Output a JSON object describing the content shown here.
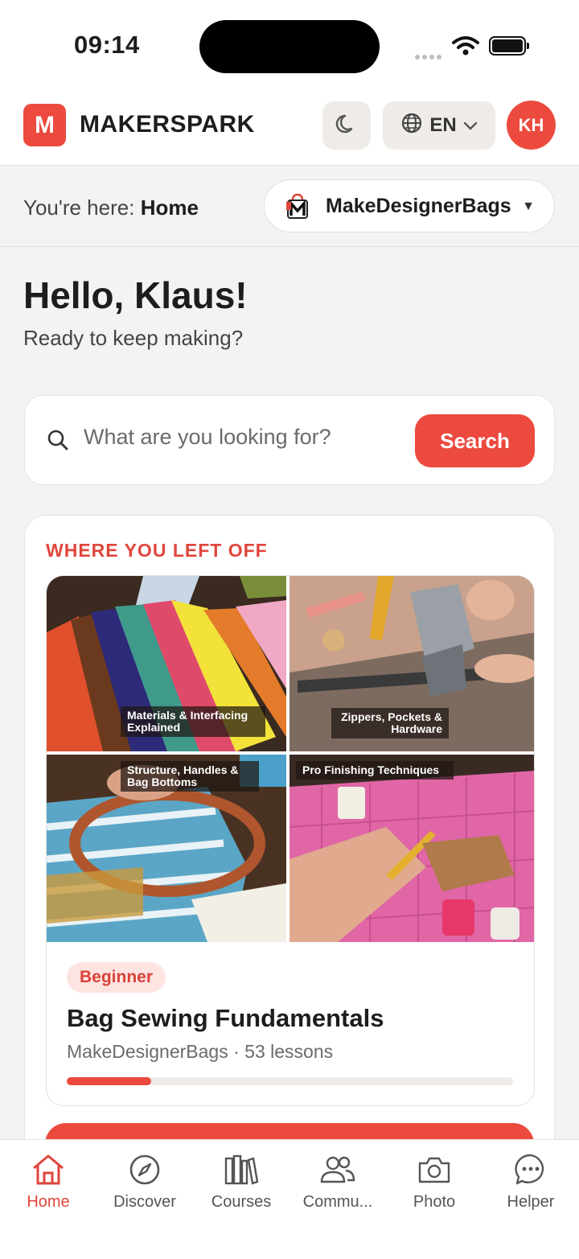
{
  "status_bar": {
    "time": "09:14"
  },
  "header": {
    "logo_letter": "M",
    "brand": "MAKERSPARK",
    "language": "EN",
    "avatar_initials": "KH"
  },
  "breadcrumb": {
    "prefix": "You're here:",
    "current": "Home",
    "brand_selector": "MakeDesignerBags"
  },
  "greeting": {
    "title": "Hello, Klaus!",
    "subtitle": "Ready to keep making?"
  },
  "search": {
    "placeholder": "What are you looking for?",
    "button": "Search"
  },
  "continue": {
    "section_title": "WHERE YOU LEFT OFF",
    "tiles": [
      {
        "label": "Materials & Interfacing Explained"
      },
      {
        "label": "Zippers, Pockets & Hardware"
      },
      {
        "label": "Structure, Handles & Bag Bottoms"
      },
      {
        "label": "Pro Finishing Techniques"
      }
    ],
    "level_badge": "Beginner",
    "course_title": "Bag Sewing Fundamentals",
    "course_meta": "MakeDesignerBags · 53 lessons",
    "progress_fraction": 0.19
  },
  "bottom_nav": {
    "items": [
      {
        "label": "Home",
        "icon": "home-icon",
        "active": true
      },
      {
        "label": "Discover",
        "icon": "compass-icon",
        "active": false
      },
      {
        "label": "Courses",
        "icon": "books-icon",
        "active": false
      },
      {
        "label": "Commu...",
        "icon": "community-icon",
        "active": false
      },
      {
        "label": "Photo",
        "icon": "camera-icon",
        "active": false
      },
      {
        "label": "Helper",
        "icon": "chat-icon",
        "active": false
      }
    ]
  },
  "colors": {
    "accent": "#ec4a3f",
    "badge_bg": "#fde4e1"
  }
}
